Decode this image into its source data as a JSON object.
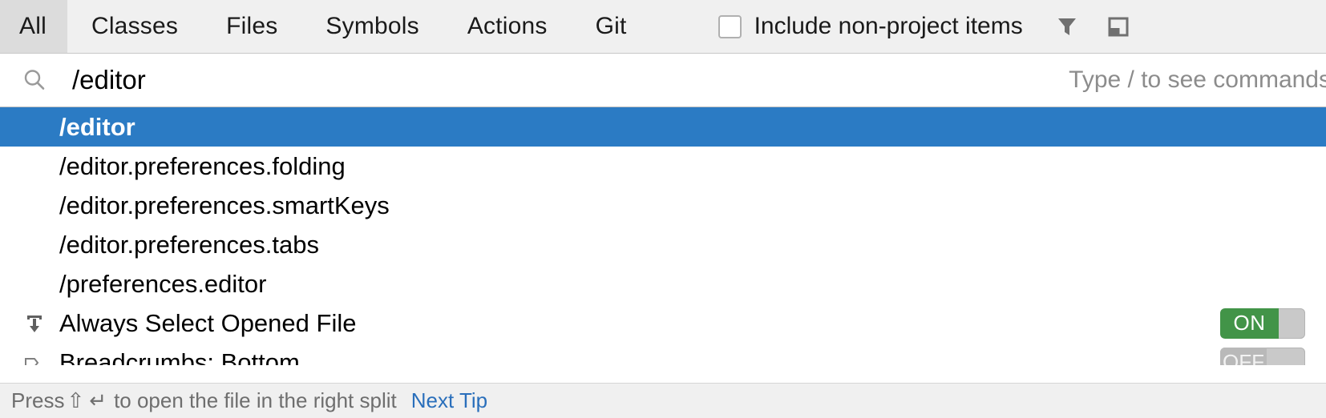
{
  "header": {
    "tabs": [
      {
        "label": "All",
        "selected": true
      },
      {
        "label": "Classes",
        "selected": false
      },
      {
        "label": "Files",
        "selected": false
      },
      {
        "label": "Symbols",
        "selected": false
      },
      {
        "label": "Actions",
        "selected": false
      },
      {
        "label": "Git",
        "selected": false
      }
    ],
    "checkbox": {
      "label": "Include non-project items",
      "checked": false
    },
    "icons": [
      {
        "name": "filter-icon"
      },
      {
        "name": "preview-panel-icon"
      }
    ]
  },
  "search": {
    "icon": "search-icon",
    "value": "/editor",
    "placeholder": "Type / to see commands",
    "hint": "Type / to see commands"
  },
  "results": [
    {
      "label": "/editor",
      "selected": true,
      "icon": null,
      "toggle": null
    },
    {
      "label": "/editor.preferences.folding",
      "selected": false,
      "icon": null,
      "toggle": null
    },
    {
      "label": "/editor.preferences.smartKeys",
      "selected": false,
      "icon": null,
      "toggle": null
    },
    {
      "label": "/editor.preferences.tabs",
      "selected": false,
      "icon": null,
      "toggle": null
    },
    {
      "label": "/preferences.editor",
      "selected": false,
      "icon": null,
      "toggle": null
    },
    {
      "label": "Always Select Opened File",
      "selected": false,
      "icon": "scroll-to-source-icon",
      "toggle": "ON"
    },
    {
      "label": "Breadcrumbs: Bottom",
      "selected": false,
      "icon": "breadcrumbs-icon",
      "toggle": "OFF"
    }
  ],
  "toggle_labels": {
    "on": "ON",
    "off": "OFF"
  },
  "statusbar": {
    "prefix": "Press",
    "shortcut_shift": "⇧",
    "shortcut_enter": "↵",
    "suffix": "to open the file in the right split",
    "tip_link": "Next Tip"
  },
  "colors": {
    "selection_blue": "#2b7bc4",
    "toggle_on_green": "#429448",
    "link_blue": "#2a6fbb",
    "header_bg": "#f0f0f0",
    "selected_tab_bg": "#dcdcdc"
  }
}
